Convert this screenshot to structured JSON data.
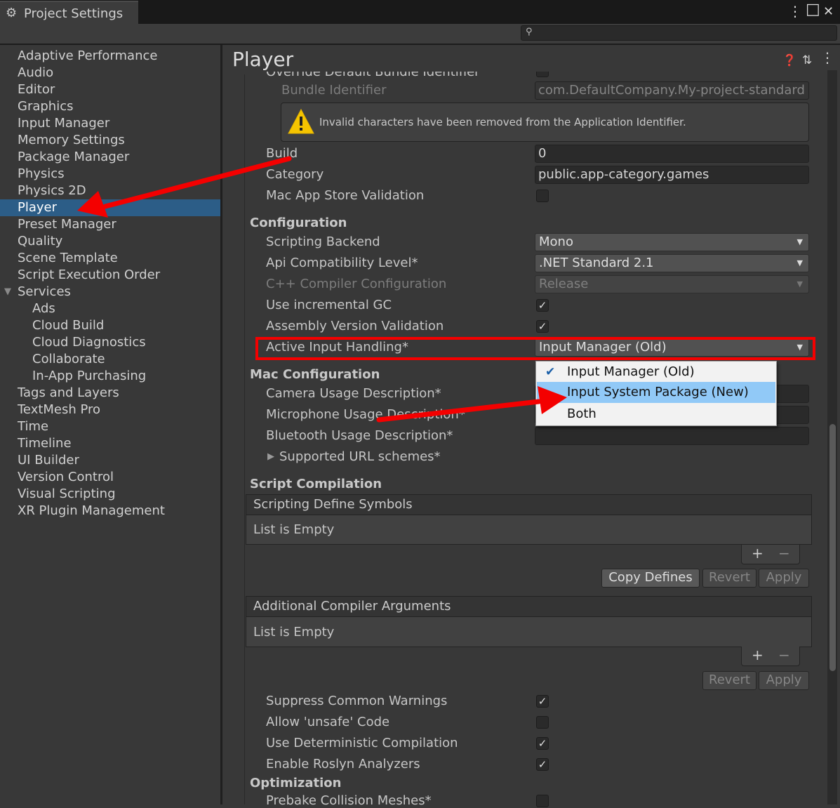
{
  "window": {
    "tab_title": "Project Settings",
    "gear_icon": "gear-icon",
    "menu_icon": "⋮",
    "maximize_icon": "□",
    "close_icon": "✕",
    "search_placeholder": ""
  },
  "sidebar": {
    "items": [
      {
        "label": "Adaptive Performance"
      },
      {
        "label": "Audio"
      },
      {
        "label": "Editor"
      },
      {
        "label": "Graphics"
      },
      {
        "label": "Input Manager"
      },
      {
        "label": "Memory Settings"
      },
      {
        "label": "Package Manager"
      },
      {
        "label": "Physics"
      },
      {
        "label": "Physics 2D"
      },
      {
        "label": "Player",
        "selected": true
      },
      {
        "label": "Preset Manager"
      },
      {
        "label": "Quality"
      },
      {
        "label": "Scene Template"
      },
      {
        "label": "Script Execution Order"
      },
      {
        "label": "Services",
        "expanded": true
      },
      {
        "label": "Ads",
        "child": true
      },
      {
        "label": "Cloud Build",
        "child": true
      },
      {
        "label": "Cloud Diagnostics",
        "child": true
      },
      {
        "label": "Collaborate",
        "child": true
      },
      {
        "label": "In-App Purchasing",
        "child": true
      },
      {
        "label": "Tags and Layers"
      },
      {
        "label": "TextMesh Pro"
      },
      {
        "label": "Time"
      },
      {
        "label": "Timeline"
      },
      {
        "label": "UI Builder"
      },
      {
        "label": "Version Control"
      },
      {
        "label": "Visual Scripting"
      },
      {
        "label": "XR Plugin Management"
      }
    ]
  },
  "main": {
    "title": "Player",
    "cut_label": "Override Default Bundle Identifier",
    "bundle_identifier_label": "Bundle Identifier",
    "bundle_identifier_value": "com.DefaultCompany.My-project-standard",
    "warning_text": "Invalid characters have been removed from the Application Identifier.",
    "build_label": "Build",
    "build_value": "0",
    "category_label": "Category",
    "category_value": "public.app-category.games",
    "mac_app_store_label": "Mac App Store Validation",
    "configuration_header": "Configuration",
    "scripting_backend_label": "Scripting Backend",
    "scripting_backend_value": "Mono",
    "api_level_label": "Api Compatibility Level*",
    "api_level_value": ".NET Standard 2.1",
    "cpp_compiler_label": "C++ Compiler Configuration",
    "cpp_compiler_value": "Release",
    "incremental_gc_label": "Use incremental GC",
    "incremental_gc_checked": true,
    "assembly_validation_label": "Assembly Version Validation",
    "assembly_validation_checked": true,
    "active_input_label": "Active Input Handling*",
    "active_input_value": "Input Manager (Old)",
    "mac_config_header": "Mac Configuration",
    "camera_usage_label": "Camera Usage Description*",
    "microphone_usage_label": "Microphone Usage Description*",
    "bluetooth_usage_label": "Bluetooth Usage Description*",
    "url_schemes_label": "Supported URL schemes*",
    "script_compilation_header": "Script Compilation",
    "define_symbols_header": "Scripting Define Symbols",
    "define_symbols_empty": "List is Empty",
    "plus": "+",
    "minus": "−",
    "copy_defines": "Copy Defines",
    "revert": "Revert",
    "apply": "Apply",
    "compiler_args_header": "Additional Compiler Arguments",
    "compiler_args_empty": "List is Empty",
    "suppress_warnings_label": "Suppress Common Warnings",
    "suppress_warnings_checked": true,
    "unsafe_code_label": "Allow 'unsafe' Code",
    "unsafe_code_checked": false,
    "deterministic_label": "Use Deterministic Compilation",
    "deterministic_checked": true,
    "roslyn_label": "Enable Roslyn Analyzers",
    "roslyn_checked": true,
    "optimization_header": "Optimization",
    "prebake_label": "Prebake Collision Meshes*"
  },
  "dropdown_popup": {
    "options": [
      {
        "label": "Input Manager (Old)",
        "checked": true
      },
      {
        "label": "Input System Package (New)",
        "highlighted": true
      },
      {
        "label": "Both"
      }
    ]
  },
  "annotations": {
    "color": "#f40000"
  }
}
